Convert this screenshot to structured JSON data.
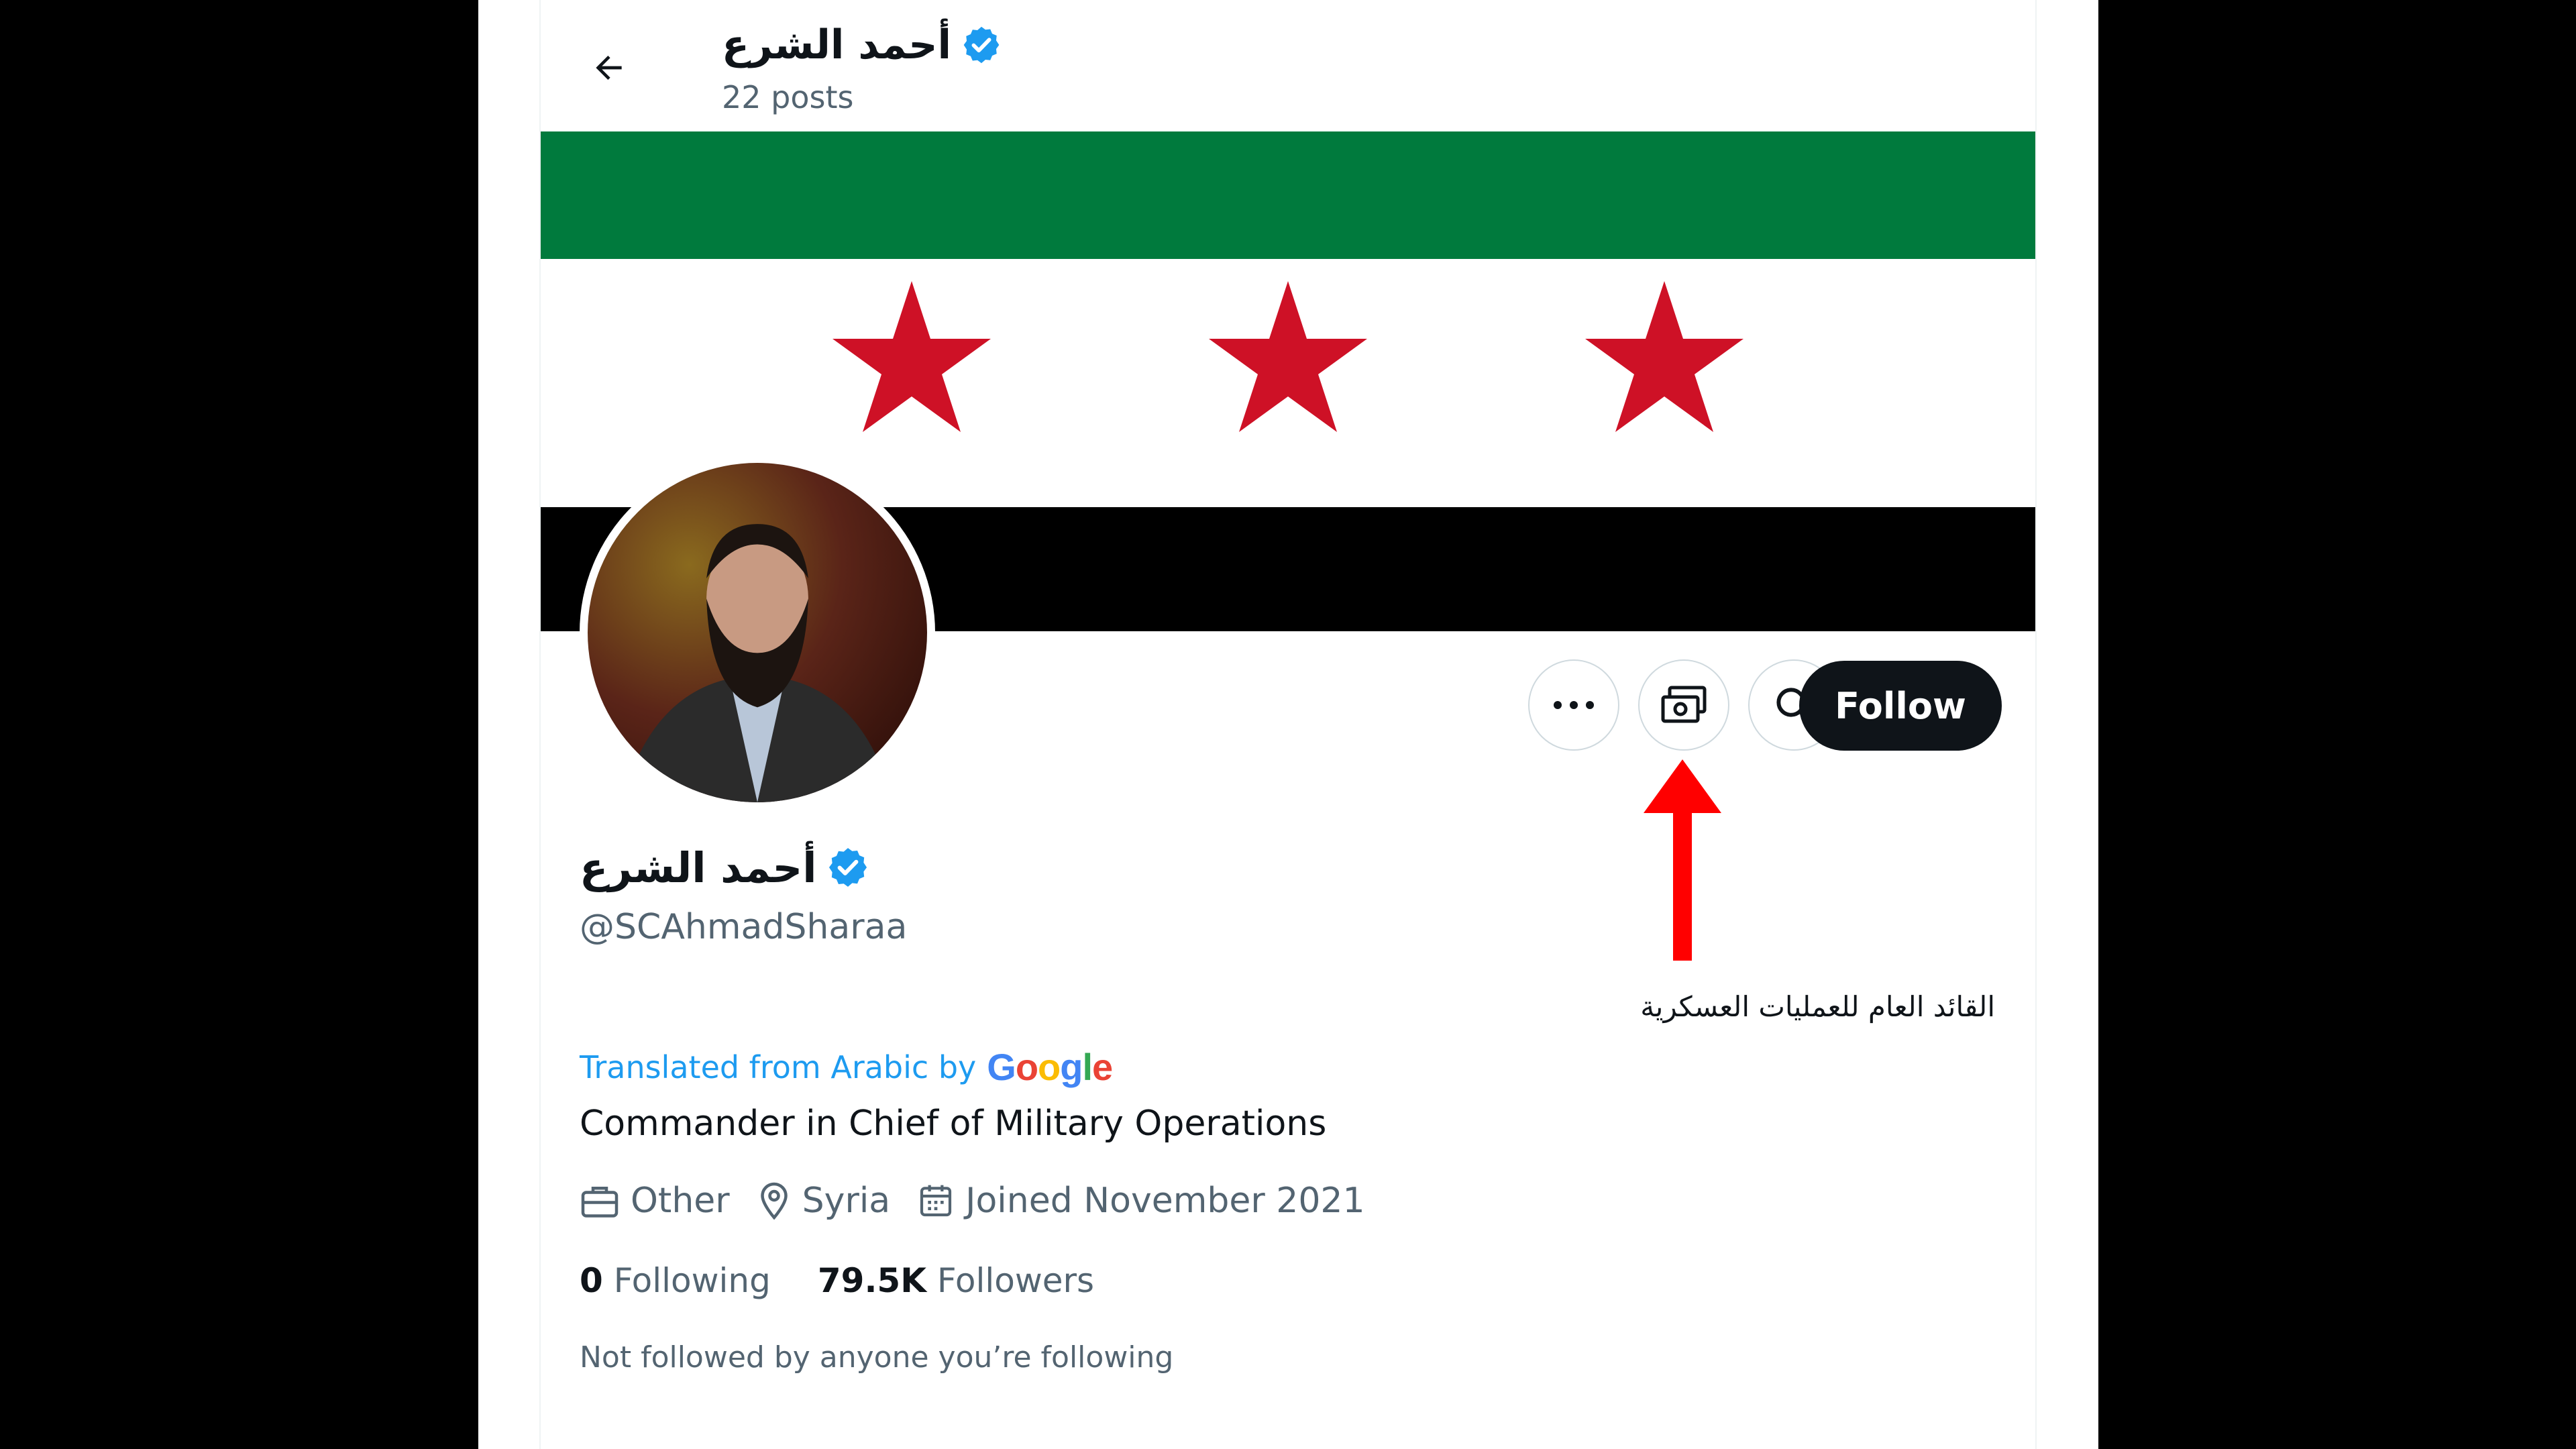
{
  "header": {
    "display_name": "أحمد الشرع",
    "posts_count": "22 posts"
  },
  "banner": {
    "description": "Syrian independence flag",
    "colors": {
      "green": "#007a3d",
      "white": "#ffffff",
      "black": "#000000",
      "star": "#ce1126"
    }
  },
  "actions": {
    "more_icon": "more-dots-icon",
    "subscribe_icon": "money-subscribe-icon",
    "search_icon": "search-icon",
    "follow_label": "Follow"
  },
  "profile": {
    "display_name": "أحمد الشرع",
    "handle": "@SCAhmadSharaa",
    "bio_arabic": "القائد العام للعمليات العسكرية",
    "translated_label": "Translated from Arabic by",
    "translation_provider": "Google",
    "bio_translated": "Commander in Chief of Military Operations",
    "category": "Other",
    "location": "Syria",
    "joined": "Joined November 2021",
    "following_count": "0",
    "following_label": "Following",
    "followers_count": "79.5K",
    "followers_label": "Followers",
    "mutuals_note": "Not followed by anyone you’re following"
  },
  "colors": {
    "verified_badge": "#1d9bf0",
    "link": "#1d9bf0",
    "text_primary": "#0f1419",
    "text_secondary": "#536471",
    "annotation_arrow": "#ff0000"
  }
}
